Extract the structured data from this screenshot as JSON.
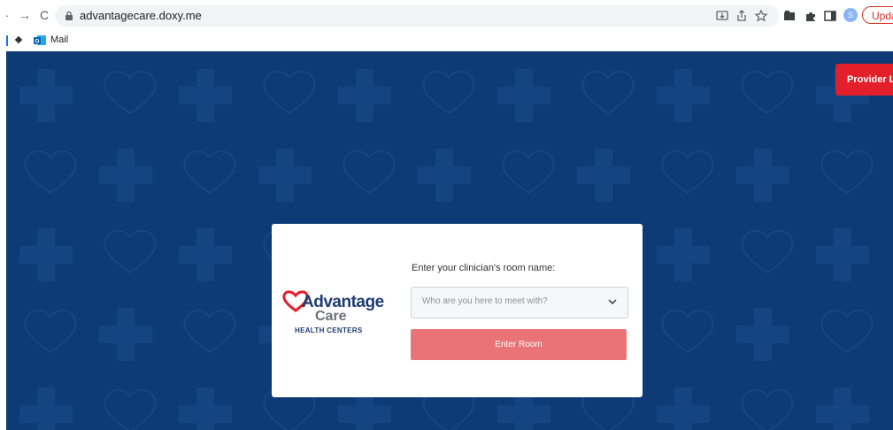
{
  "browser": {
    "url": "advantagecare.doxy.me",
    "profile_initial": "S",
    "update_label": "Upda"
  },
  "bookmarks": {
    "mail_label": "Mail"
  },
  "page": {
    "provider_login_label": "Provider Lo",
    "logo": {
      "line1": "Advantage",
      "line2": "Care",
      "line3": "HEALTH CENTERS"
    },
    "room_prompt": "Enter your clinician's room name:",
    "room_select_placeholder": "Who are you here to meet with?",
    "enter_room_label": "Enter Room"
  },
  "colors": {
    "background": "#0e3b75",
    "provider_button": "#e21f2a",
    "enter_button": "#e97376",
    "logo_blue": "#1e3c72",
    "logo_red": "#e21f2a"
  }
}
